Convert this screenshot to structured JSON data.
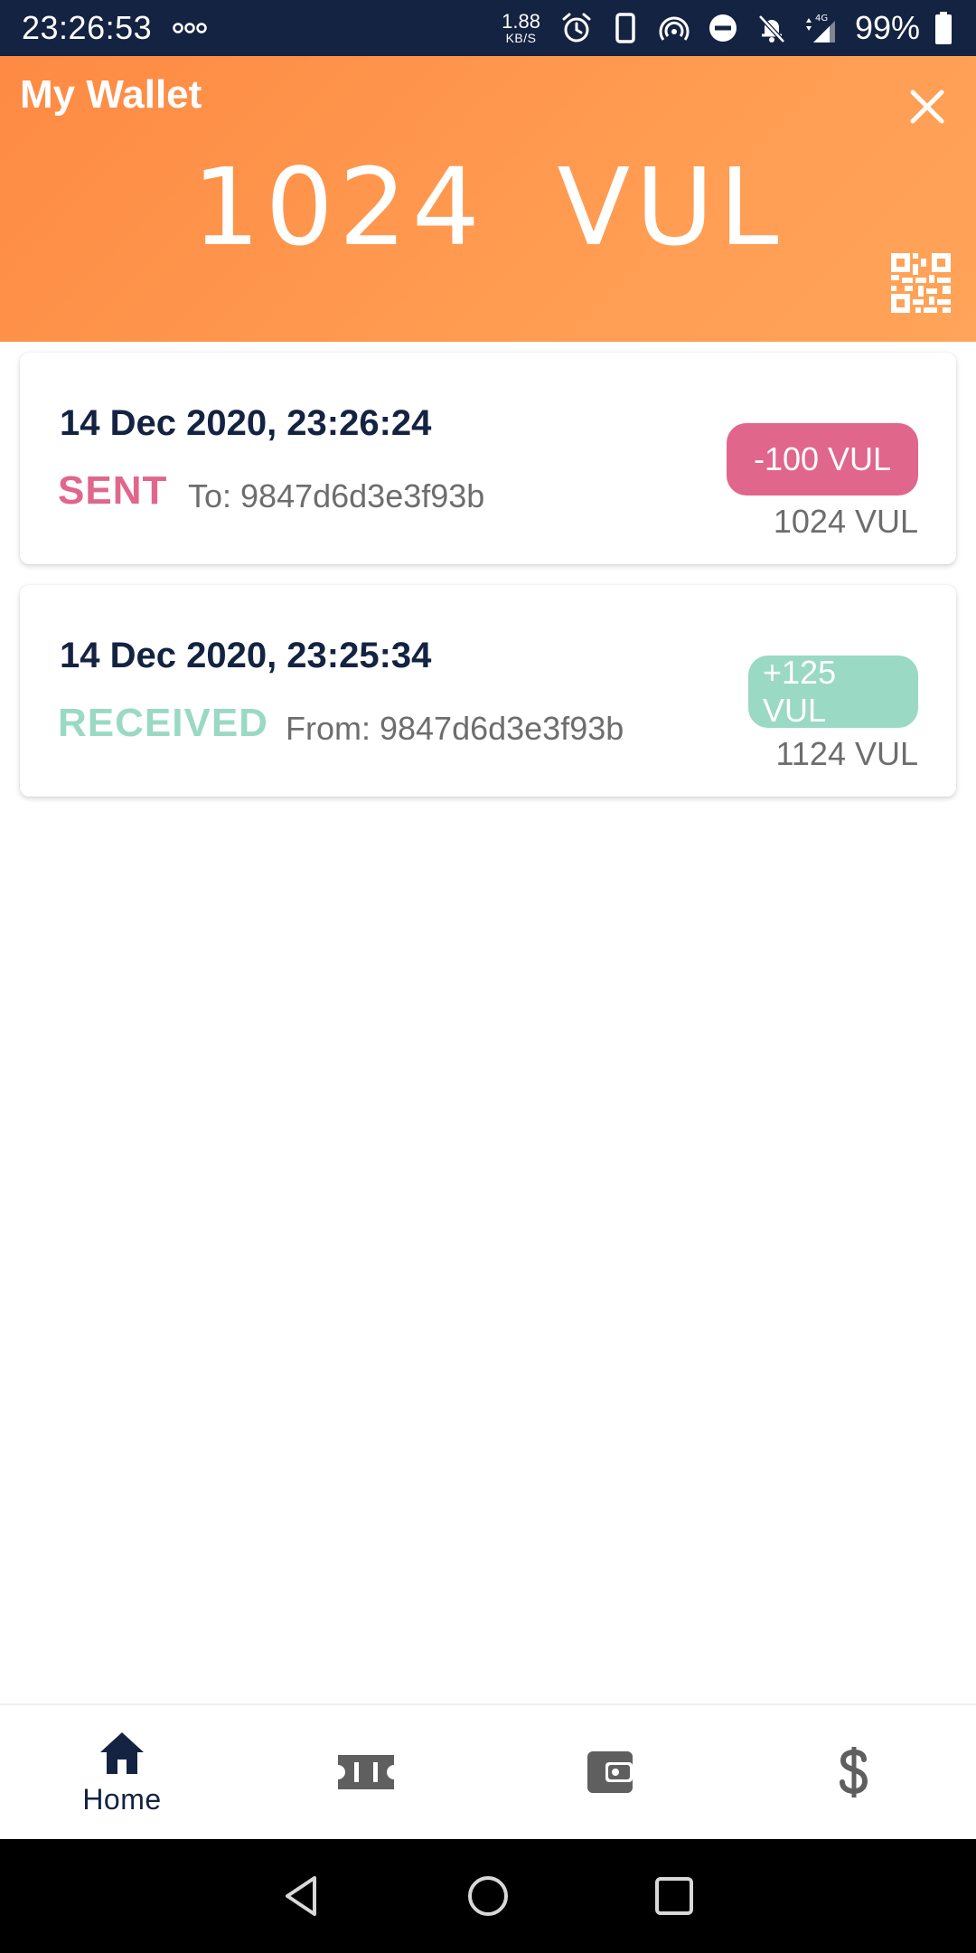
{
  "status_bar": {
    "time": "23:26:53",
    "speed_value": "1.88",
    "speed_unit": "KB/S",
    "network": "4G",
    "battery": "99%"
  },
  "header": {
    "title": "My Wallet",
    "balance": "1024 VUL",
    "close_icon": "close-icon",
    "qr_icon": "qr-code-icon"
  },
  "transactions": [
    {
      "datetime": "14 Dec 2020, 23:26:24",
      "type": "SENT",
      "address": "To: 9847d6d3e3f93b",
      "amount": "-100 VUL",
      "balance_after": "1024 VUL"
    },
    {
      "datetime": "14 Dec 2020, 23:25:34",
      "type": "RECEIVED",
      "address": "From: 9847d6d3e3f93b",
      "amount": "+125 VUL",
      "balance_after": "1124 VUL"
    }
  ],
  "bottom_nav": {
    "items": [
      {
        "icon": "home-icon",
        "label": "Home",
        "active": true
      },
      {
        "icon": "ticket-icon",
        "label": "",
        "active": false
      },
      {
        "icon": "wallet-icon",
        "label": "",
        "active": false
      },
      {
        "icon": "dollar-icon",
        "label": "",
        "active": false
      }
    ]
  },
  "colors": {
    "header_gradient_start": "#fe8a43",
    "header_gradient_end": "#ffa45a",
    "status_bar": "#142342",
    "sent": "#e0668b",
    "received": "#9ad9c4",
    "navy": "#142342",
    "nav_inactive": "#5f5f5f"
  }
}
